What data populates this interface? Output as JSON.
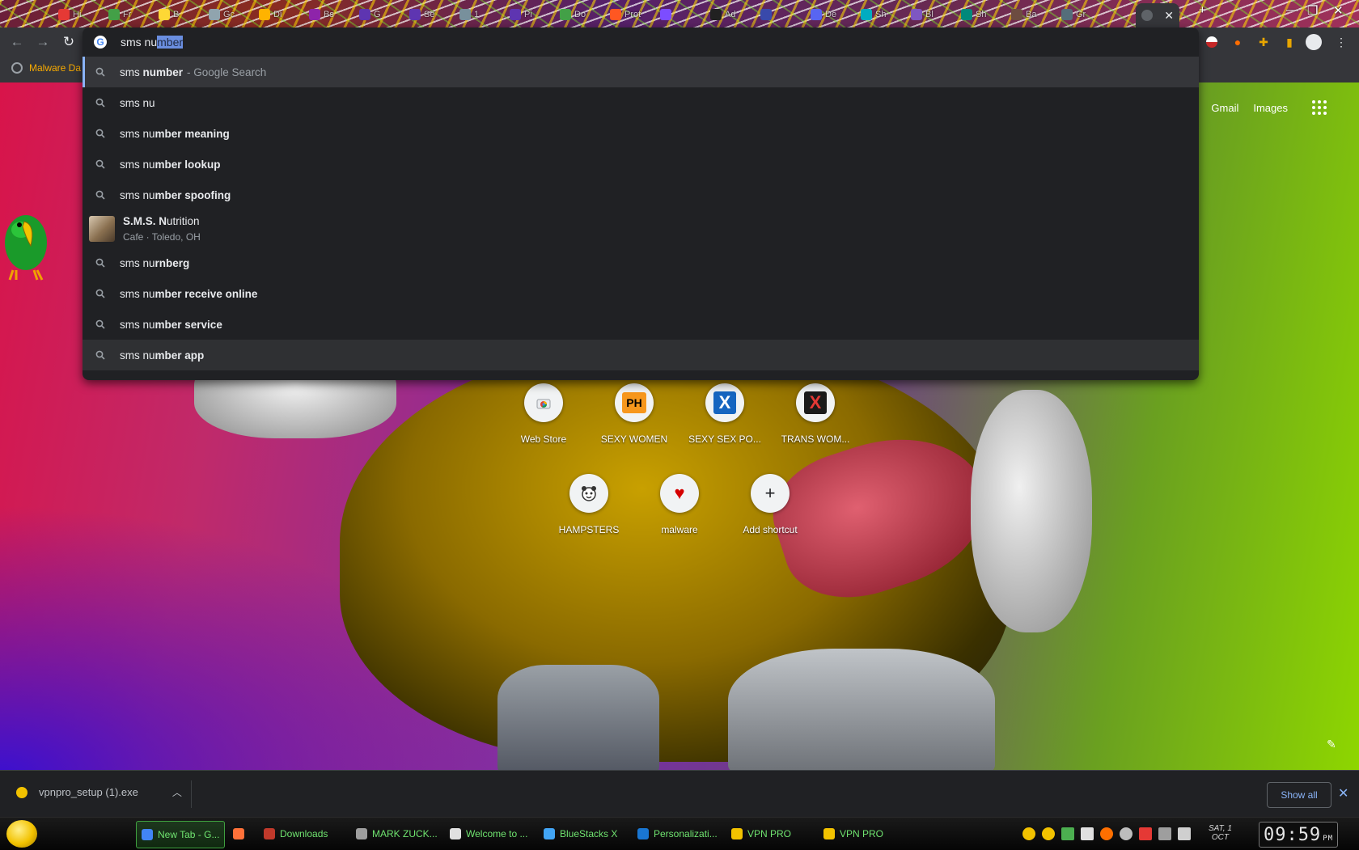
{
  "window": {
    "tabs": [
      {
        "icon": "mail-icon",
        "label": "Hi"
      },
      {
        "icon": "download-icon",
        "label": "Fr"
      },
      {
        "icon": "shield-icon",
        "label": "B"
      },
      {
        "icon": "calendar-icon",
        "label": "Gc"
      },
      {
        "icon": "star-icon",
        "label": "Di"
      },
      {
        "icon": "rainbow-icon",
        "label": "Bs"
      },
      {
        "icon": "alien-icon",
        "label": "G"
      },
      {
        "icon": "alien-icon",
        "label": "Se"
      },
      {
        "icon": "globe-icon",
        "label": "1"
      },
      {
        "icon": "alien-icon",
        "label": "Pi"
      },
      {
        "icon": "puzzle-icon",
        "label": "Do"
      },
      {
        "icon": "reddit-icon",
        "label": "Prot"
      },
      {
        "icon": "c-icon",
        "label": ""
      },
      {
        "icon": "box-icon",
        "label": "Ad"
      },
      {
        "icon": "rsg-icon",
        "label": ""
      },
      {
        "icon": "discord-icon",
        "label": "De"
      },
      {
        "icon": "tab-icon",
        "label": "Sh"
      },
      {
        "icon": "ghost-icon",
        "label": "Bl"
      },
      {
        "icon": "tab-icon",
        "label": "Sh"
      },
      {
        "icon": "tab-icon",
        "label": "Ba"
      },
      {
        "icon": "tab-icon",
        "label": "Gr"
      }
    ],
    "controls": {
      "minimize": "—",
      "restore": "❐",
      "close": "✕"
    }
  },
  "bookmarks": {
    "item": "Malware Da"
  },
  "omnibox": {
    "typed": "sms nu",
    "autocomplete": "mber",
    "suggestions": [
      {
        "prefix": "sms ",
        "bold": "number",
        "suffix": " - Google Search",
        "selected": true
      },
      {
        "prefix": "sms nu",
        "bold": ""
      },
      {
        "prefix": "sms nu",
        "bold": "mber meaning"
      },
      {
        "prefix": "sms nu",
        "bold": "mber lookup"
      },
      {
        "prefix": "sms nu",
        "bold": "mber spoofing"
      }
    ],
    "entity": {
      "title_bold": "S.M.S. N",
      "title_rest": "utrition",
      "subtitle": "Cafe · Toledo, OH"
    },
    "suggestions2": [
      {
        "prefix": "sms nu",
        "bold": "rnberg"
      },
      {
        "prefix": "sms nu",
        "bold": "mber receive online"
      },
      {
        "prefix": "sms nu",
        "bold": "mber service"
      },
      {
        "prefix": "sms nu",
        "bold": "mber app"
      }
    ]
  },
  "header_links": {
    "gmail": "Gmail",
    "images": "Images"
  },
  "shortcuts": [
    {
      "title": "Web Store",
      "icon": "webstore-icon"
    },
    {
      "title": "SEXY WOMEN",
      "icon": "ph-icon",
      "badge": "PH"
    },
    {
      "title": "SEXY SEX PO...",
      "icon": "x-blue-icon",
      "badge": "X"
    },
    {
      "title": "TRANS WOM...",
      "icon": "x-red-icon",
      "badge": "X"
    },
    {
      "title": "HAMPSTERS",
      "icon": "hamster-icon"
    },
    {
      "title": "malware",
      "icon": "heart-icon"
    },
    {
      "title": "Add shortcut",
      "icon": "plus-icon"
    }
  ],
  "download": {
    "filename": "vpnpro_setup (1).exe",
    "show_all": "Show all"
  },
  "taskbar": {
    "items": [
      {
        "label": "New Tab - G...",
        "active": true,
        "color": "#4285f4"
      },
      {
        "label": "",
        "active": false,
        "color": "#ff7139"
      },
      {
        "label": "Downloads",
        "active": false,
        "color": "#c0392b"
      },
      {
        "label": "MARK ZUCK...",
        "active": false,
        "color": "#9e9e9e"
      },
      {
        "label": "Welcome to ...",
        "active": false,
        "color": "#e0e0e0"
      },
      {
        "label": "BlueStacks X",
        "active": false,
        "color": "#42a5f5"
      },
      {
        "label": "Personalizati...",
        "active": false,
        "color": "#1976d2"
      },
      {
        "label": "VPN PRO",
        "active": false,
        "color": "#f2c200"
      },
      {
        "label": "VPN PRO",
        "active": false,
        "color": "#f2c200"
      }
    ],
    "date_day": "SAT, 1",
    "date_month": "OCT",
    "clock": "09:59",
    "clock_ampm": "PM"
  }
}
